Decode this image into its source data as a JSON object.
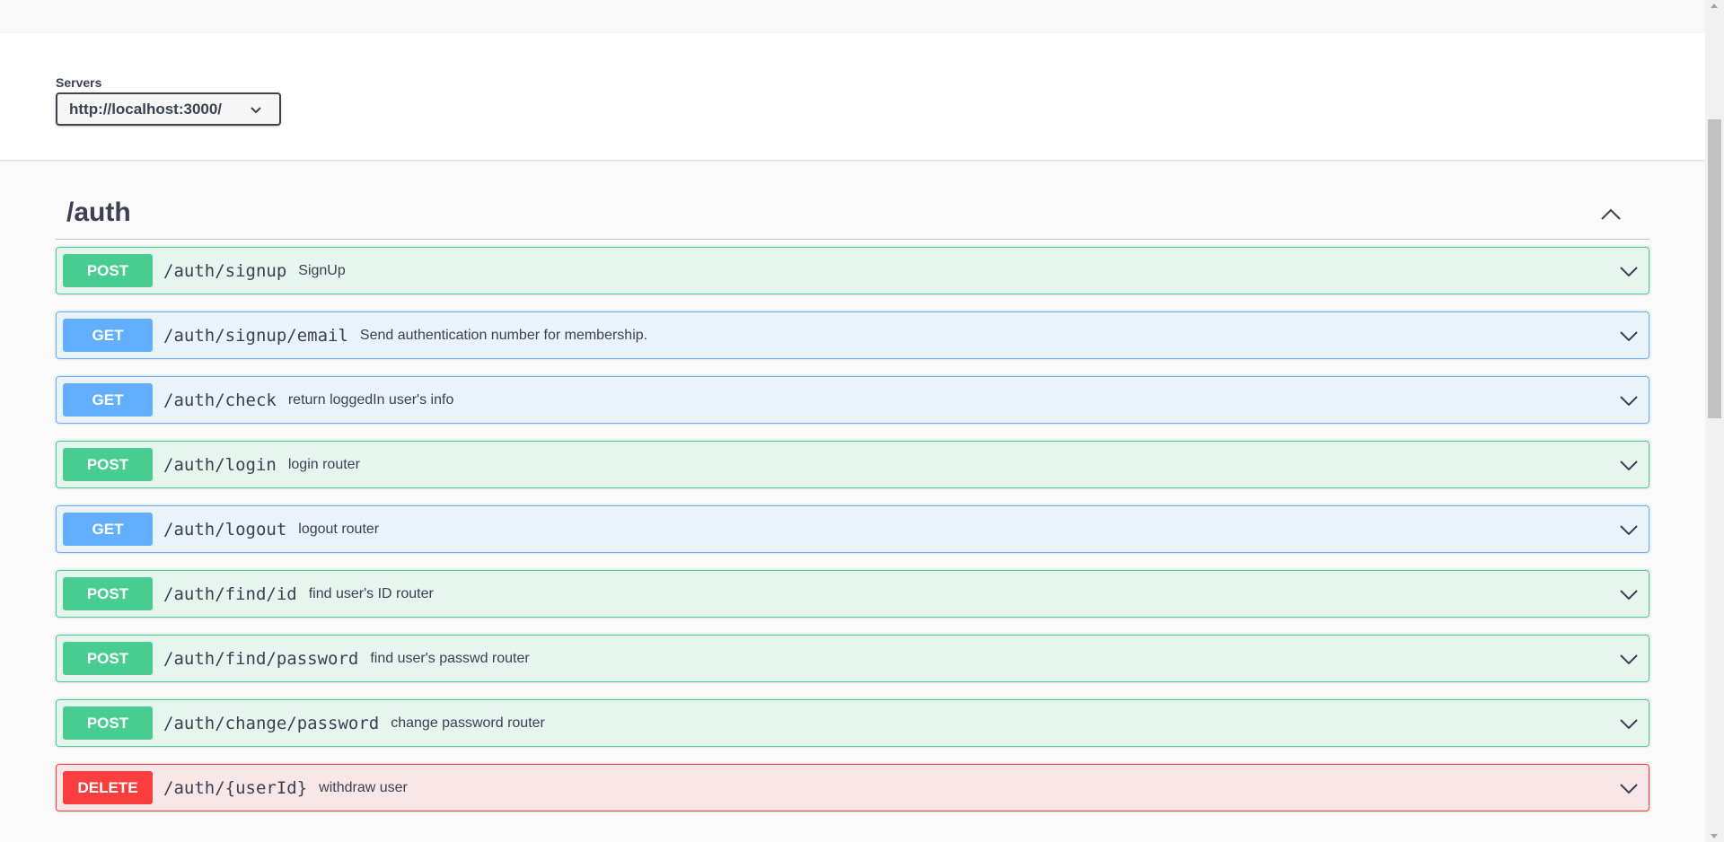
{
  "servers": {
    "label": "Servers",
    "selected": "http://localhost:3000/"
  },
  "tag": {
    "title": "/auth",
    "expanded": true
  },
  "operations": [
    {
      "method": "POST",
      "path": "/auth/signup",
      "summary": "SignUp"
    },
    {
      "method": "GET",
      "path": "/auth/signup/email",
      "summary": "Send authentication number for membership."
    },
    {
      "method": "GET",
      "path": "/auth/check",
      "summary": "return loggedIn user's info"
    },
    {
      "method": "POST",
      "path": "/auth/login",
      "summary": "login router"
    },
    {
      "method": "GET",
      "path": "/auth/logout",
      "summary": "logout router"
    },
    {
      "method": "POST",
      "path": "/auth/find/id",
      "summary": "find user's ID router"
    },
    {
      "method": "POST",
      "path": "/auth/find/password",
      "summary": "find user's passwd router"
    },
    {
      "method": "POST",
      "path": "/auth/change/password",
      "summary": "change password router"
    },
    {
      "method": "DELETE",
      "path": "/auth/{userId}",
      "summary": "withdraw user"
    }
  ],
  "colors": {
    "post": "#49cc90",
    "get": "#61affe",
    "delete": "#f93e3e",
    "text": "#3b4151"
  },
  "icons": {
    "server_select": "chevron-down-icon",
    "tag_toggle": "chevron-up-icon",
    "operation_toggle": "chevron-down-icon"
  }
}
